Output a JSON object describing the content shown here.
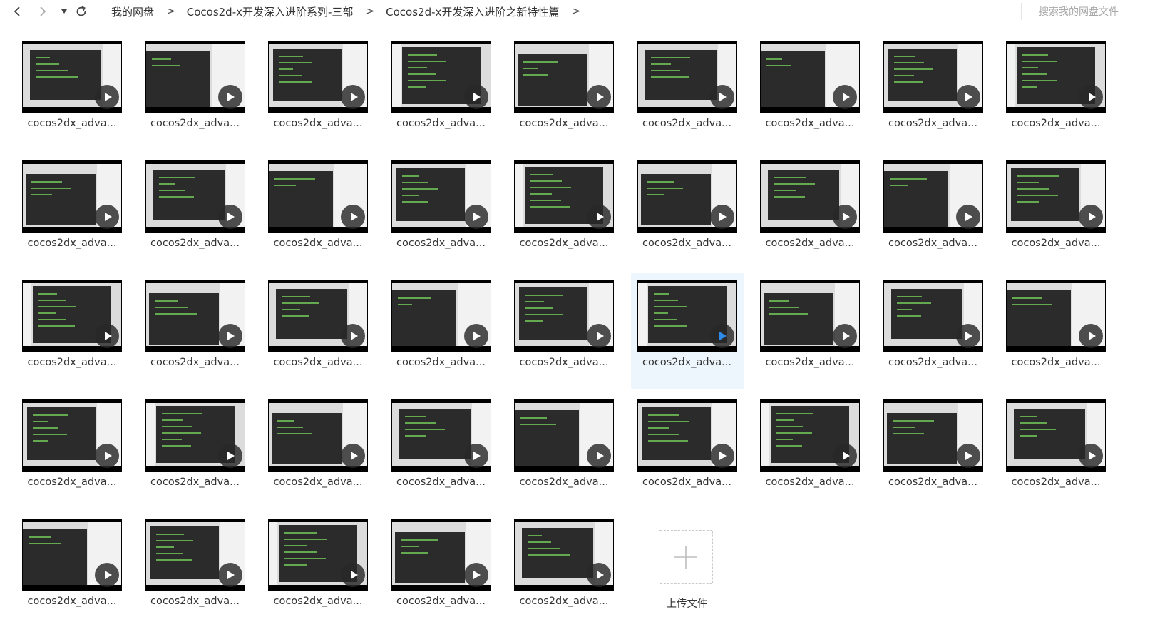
{
  "toolbar": {
    "back_icon": "chevron-left-icon",
    "forward_icon": "chevron-right-icon",
    "history_icon": "caret-down-icon",
    "refresh_icon": "refresh-icon"
  },
  "breadcrumb": [
    "我的网盘",
    "Cocos2d-x开发深入进阶系列-三部",
    "Cocos2d-x开发深入进阶之新特性篇"
  ],
  "breadcrumb_separator": ">",
  "search": {
    "placeholder": "搜索我的网盘文件",
    "value": ""
  },
  "files": [
    {
      "label": "cocos2dx_adva...",
      "selected": false
    },
    {
      "label": "cocos2dx_adva...",
      "selected": false
    },
    {
      "label": "cocos2dx_adva...",
      "selected": false
    },
    {
      "label": "cocos2dx_adva...",
      "selected": false
    },
    {
      "label": "cocos2dx_adva...",
      "selected": false
    },
    {
      "label": "cocos2dx_adva...",
      "selected": false
    },
    {
      "label": "cocos2dx_adva...",
      "selected": false
    },
    {
      "label": "cocos2dx_adva...",
      "selected": false
    },
    {
      "label": "cocos2dx_adva...",
      "selected": false
    },
    {
      "label": "cocos2dx_adva...",
      "selected": false
    },
    {
      "label": "cocos2dx_adva...",
      "selected": false
    },
    {
      "label": "cocos2dx_adva...",
      "selected": false
    },
    {
      "label": "cocos2dx_adva...",
      "selected": false
    },
    {
      "label": "cocos2dx_adva...",
      "selected": false
    },
    {
      "label": "cocos2dx_adva...",
      "selected": false
    },
    {
      "label": "cocos2dx_adva...",
      "selected": false
    },
    {
      "label": "cocos2dx_adva...",
      "selected": false
    },
    {
      "label": "cocos2dx_adva...",
      "selected": false
    },
    {
      "label": "cocos2dx_adva...",
      "selected": false
    },
    {
      "label": "cocos2dx_adva...",
      "selected": false
    },
    {
      "label": "cocos2dx_adva...",
      "selected": false
    },
    {
      "label": "cocos2dx_adva...",
      "selected": false
    },
    {
      "label": "cocos2dx_adva...",
      "selected": false
    },
    {
      "label": "cocos2dx_adva...",
      "selected": true
    },
    {
      "label": "cocos2dx_adva...",
      "selected": false
    },
    {
      "label": "cocos2dx_adva...",
      "selected": false
    },
    {
      "label": "cocos2dx_adva...",
      "selected": false
    },
    {
      "label": "cocos2dx_adva...",
      "selected": false
    },
    {
      "label": "cocos2dx_adva...",
      "selected": false
    },
    {
      "label": "cocos2dx_adva...",
      "selected": false
    },
    {
      "label": "cocos2dx_adva...",
      "selected": false
    },
    {
      "label": "cocos2dx_adva...",
      "selected": false
    },
    {
      "label": "cocos2dx_adva...",
      "selected": false
    },
    {
      "label": "cocos2dx_adva...",
      "selected": false
    },
    {
      "label": "cocos2dx_adva...",
      "selected": false
    },
    {
      "label": "cocos2dx_adva...",
      "selected": false
    },
    {
      "label": "cocos2dx_adva...",
      "selected": false
    },
    {
      "label": "cocos2dx_adva...",
      "selected": false
    },
    {
      "label": "cocos2dx_adva...",
      "selected": false
    },
    {
      "label": "cocos2dx_adva...",
      "selected": false
    },
    {
      "label": "cocos2dx_adva...",
      "selected": false
    }
  ],
  "upload": {
    "label": "上传文件",
    "icon": "plus-icon"
  },
  "colors": {
    "selected_bg": "#eef6fd",
    "play_active": "#2f8be8",
    "text": "#333333",
    "placeholder": "#a8a8a8"
  }
}
